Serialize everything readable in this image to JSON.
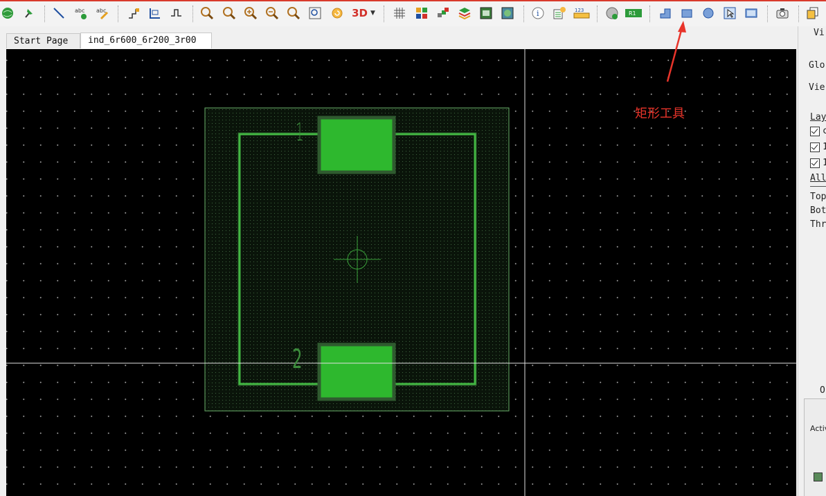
{
  "tabs": [
    {
      "label": "Start Page",
      "active": false
    },
    {
      "label": "ind_6r600_6r200_3r00",
      "active": true
    }
  ],
  "toolbar": {
    "icons": [
      "globe-icon",
      "pin-icon",
      "line-icon",
      "add-text-icon",
      "edit-text-icon",
      "route-icon",
      "dimension-icon",
      "track-icon",
      "zoom-area-icon",
      "zoom-fit-icon",
      "zoom-in-icon",
      "zoom-out-icon",
      "zoom-redraw-icon",
      "zoom-selection-icon",
      "refresh-icon",
      "view-3d-icon",
      "grid-icon",
      "components-icon",
      "layers-icon",
      "stack-icon",
      "board-icon",
      "map-icon",
      "info-icon",
      "properties-icon",
      "measure-icon",
      "via-icon",
      "ref-label-icon",
      "polygon-tool-icon",
      "rectangle-tool-icon",
      "circle-tool-icon",
      "select-tool-icon",
      "region-tool-icon",
      "camera-icon",
      "copy-icon"
    ],
    "view_3d_label": "3D",
    "measure_label": "123",
    "ref_label": "R1"
  },
  "canvas": {
    "pad_labels": [
      "1",
      "2"
    ]
  },
  "annotation": {
    "text": "矩形工具",
    "color": "#e8342a"
  },
  "right_panel": {
    "view_label": "Vi",
    "global_label": "Glo",
    "view2_label": "Vie",
    "layers_label": "Lay",
    "layer_checks": [
      "c",
      "1",
      "1"
    ],
    "all_label": "All",
    "top_label": "Top",
    "bottom_label": "Bot",
    "through_label": "Thr",
    "options_label": "Op",
    "active_label": "Activ"
  },
  "colors": {
    "pad": "#2eb82e",
    "pad_border": "#2f5a2f",
    "outline": "#48c848",
    "annotation_arrow": "#e8342a"
  }
}
